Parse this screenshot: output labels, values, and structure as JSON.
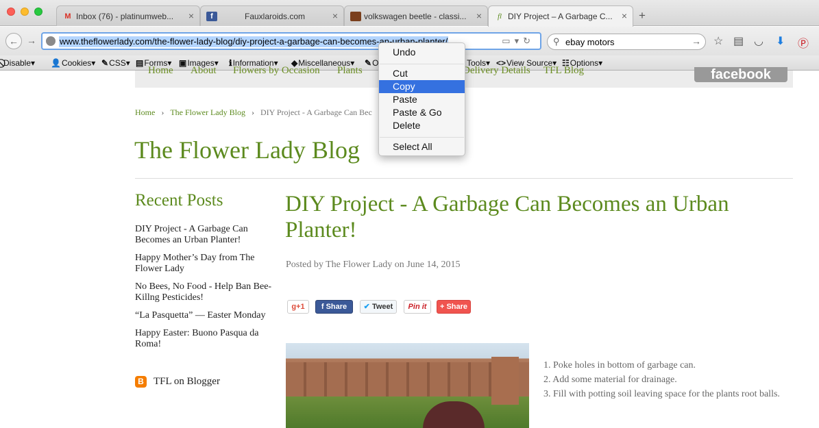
{
  "browser": {
    "tabs": [
      {
        "label": "Inbox (76) - platinumweb...",
        "icon": "gmail-icon",
        "active": false
      },
      {
        "label": "Fauxlaroids.com",
        "icon": "facebook-icon",
        "active": false
      },
      {
        "label": "volkswagen beetle - classi...",
        "icon": "shopping-bag-icon",
        "active": false
      },
      {
        "label": "DIY Project – A Garbage C...",
        "icon": "flower-lady-icon",
        "active": true
      }
    ],
    "url": "www.theflowerlady.com/the-flower-lady-blog/diy-project-a-garbage-can-becomes-an-urban-planter/",
    "search_value": "ebay motors",
    "devbar": [
      {
        "icon": "⃠",
        "label": "Disable▾"
      },
      {
        "icon": "👤",
        "label": "Cookies▾"
      },
      {
        "icon": "✎",
        "label": "CSS▾"
      },
      {
        "icon": "▤",
        "label": "Forms▾"
      },
      {
        "icon": "▣",
        "label": "Images▾"
      },
      {
        "icon": "ℹ",
        "label": "Information▾"
      },
      {
        "icon": "◆",
        "label": "Miscellaneous▾"
      },
      {
        "icon": "✎",
        "label": "O"
      },
      {
        "icon": "",
        "label": "Tools▾"
      },
      {
        "icon": "<>",
        "label": "View Source▾"
      },
      {
        "icon": "☷",
        "label": "Options▾"
      }
    ]
  },
  "context_menu": {
    "items": [
      {
        "label": "Undo",
        "selected": false
      },
      {
        "label": "Cut",
        "selected": false
      },
      {
        "label": "Copy",
        "selected": true
      },
      {
        "label": "Paste",
        "selected": false
      },
      {
        "label": "Paste & Go",
        "selected": false
      },
      {
        "label": "Delete",
        "selected": false
      },
      {
        "label": "Select All",
        "selected": false
      }
    ]
  },
  "site": {
    "nav": [
      "Home",
      "About",
      "Flowers by Occasion",
      "Plants",
      "Delivery Details",
      "TFL Blog"
    ],
    "facebook_label": "facebook",
    "breadcrumb": {
      "home": "Home",
      "blog": "The Flower Lady Blog",
      "current": "DIY Project - A Garbage Can Bec"
    },
    "blog_title": "The Flower Lady Blog",
    "sidebar_title": "Recent Posts",
    "recent_posts": [
      "DIY Project - A Garbage Can Becomes an Urban Planter!",
      "Happy Mother’s Day from The Flower Lady",
      "No Bees, No Food - Help Ban Bee-Killng Pesticides!",
      "“La Pasquetta” — Easter Monday",
      "Happy Easter: Buono Pasqua da Roma!"
    ],
    "blogger_label": "TFL on Blogger",
    "post": {
      "title": "DIY Project - A Garbage Can Becomes an Urban Planter!",
      "meta": "Posted by The Flower Lady on June 14, 2015",
      "steps": [
        "1. Poke holes in bottom of garbage can.",
        "2. Add some material for drainage.",
        "3. Fill with potting soil leaving space for the plants root balls."
      ]
    },
    "share": {
      "gplus": "g+1",
      "facebook": "Share",
      "twitter": "Tweet",
      "pinterest": "Pin it",
      "share": "Share"
    }
  },
  "colors": {
    "accent_green": "#5c8a1e",
    "menu_highlight": "#3571e0",
    "url_selection": "#b4d5fe"
  }
}
